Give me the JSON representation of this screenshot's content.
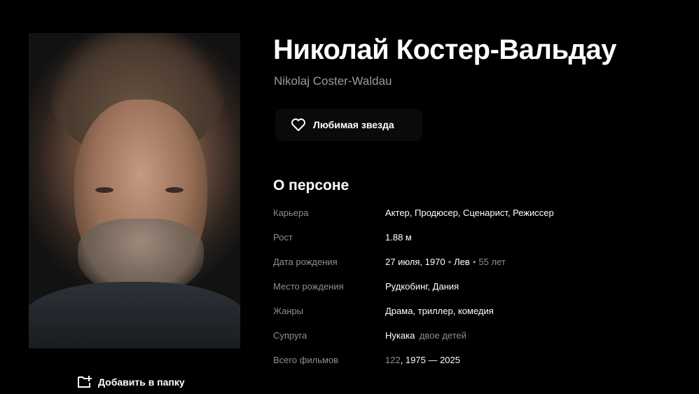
{
  "person": {
    "name": "Николай Костер-Вальдау",
    "original_name": "Nikolaj Coster-Waldau"
  },
  "actions": {
    "favorite_label": "Любимая звезда",
    "add_to_folder_label": "Добавить в папку"
  },
  "about": {
    "heading": "О персоне",
    "career": {
      "label": "Карьера",
      "value": "Актер, Продюсер, Сценарист, Режиссер"
    },
    "height": {
      "label": "Рост",
      "value": "1.88 м"
    },
    "birth_date": {
      "label": "Дата рождения",
      "date": "27 июля, 1970",
      "zodiac": "Лев",
      "age": "55 лет"
    },
    "birth_place": {
      "label": "Место рождения",
      "value": "Рудкобинг, Дания"
    },
    "genres": {
      "label": "Жанры",
      "value": "Драма, триллер, комедия"
    },
    "spouse": {
      "label": "Супруга",
      "name": "Нукака",
      "note": "двое детей"
    },
    "total_films": {
      "label": "Всего фильмов",
      "count": "122",
      "range": ", 1975 — 2025"
    }
  },
  "colors": {
    "background": "#000000",
    "text": "#ffffff",
    "secondary": "#8e8e8e"
  },
  "icons": {
    "favorite": "heart-icon",
    "add_folder": "folder-plus-icon"
  }
}
